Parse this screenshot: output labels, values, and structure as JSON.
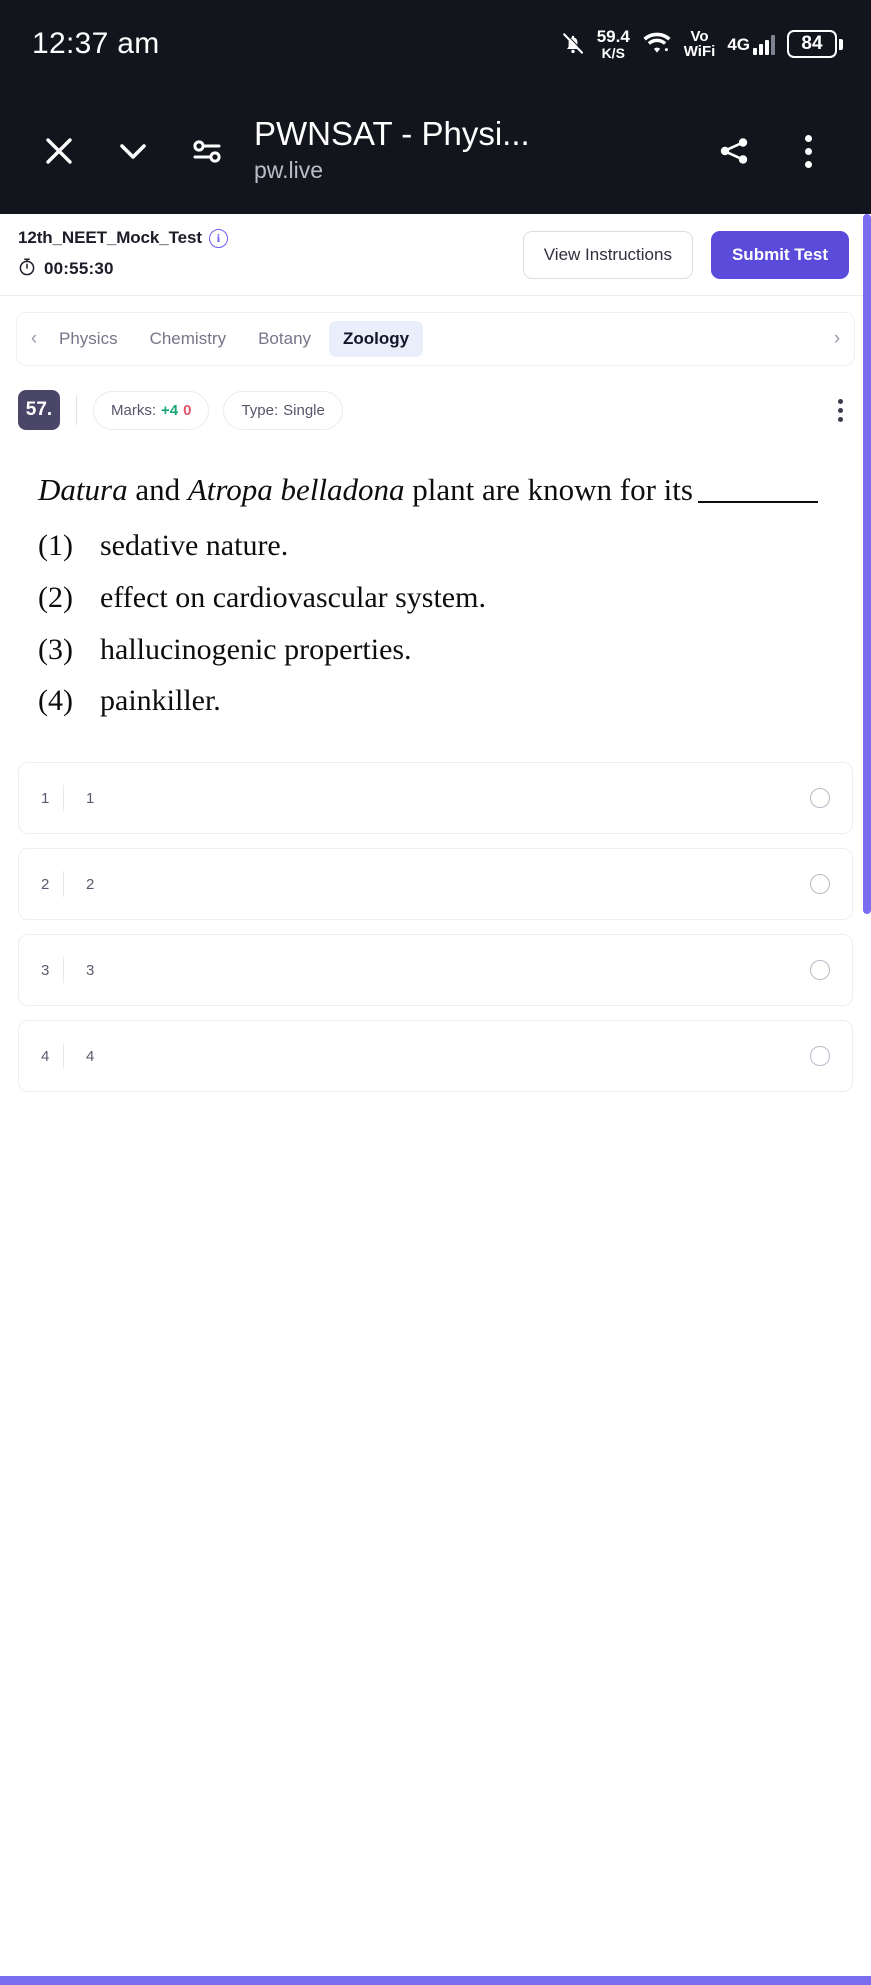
{
  "status_bar": {
    "time": "12:37 am",
    "network_speed_value": "59.4",
    "network_speed_unit": "K/S",
    "vo_line1": "Vo",
    "vo_line2": "WiFi",
    "network_gen": "4G",
    "battery_level": "84",
    "icons": [
      "bell-mute-icon",
      "wifi-icon",
      "signal-bars-icon",
      "battery-icon"
    ]
  },
  "browser": {
    "close_label": "✕",
    "page_title": "PWNSAT - Physi...",
    "host": "pw.live",
    "icons": [
      "close-icon",
      "chevron-down-icon",
      "tune-icon",
      "share-icon",
      "overflow-menu-icon"
    ]
  },
  "test_header": {
    "test_name": "12th_NEET_Mock_Test",
    "info_glyph": "i",
    "timer": "00:55:30",
    "view_instructions_label": "View Instructions",
    "submit_label": "Submit Test",
    "primary_color": "#5a4bda"
  },
  "tabs": {
    "prev_arrow": "‹",
    "next_arrow": "›",
    "items": [
      {
        "label": "Physics",
        "active": false
      },
      {
        "label": "Chemistry",
        "active": false
      },
      {
        "label": "Botany",
        "active": false
      },
      {
        "label": "Zoology",
        "active": true
      }
    ],
    "active_bg": "#e9eefb"
  },
  "question": {
    "number": "57.",
    "marks_label": "Marks:",
    "marks_positive": "+4",
    "marks_negative": "0",
    "type_label": "Type:",
    "type_value": "Single",
    "stem_part1": "Datura",
    "stem_part2": " and ",
    "stem_part3": "Atropa belladona",
    "stem_part4": " plant are known for its",
    "options": [
      {
        "num": "(1)",
        "text": "sedative nature."
      },
      {
        "num": "(2)",
        "text": "effect on cardiovascular system."
      },
      {
        "num": "(3)",
        "text": "hallucinogenic properties."
      },
      {
        "num": "(4)",
        "text": "painkiller."
      }
    ]
  },
  "answer_rows": [
    {
      "index": "1",
      "label": "1",
      "selected": false
    },
    {
      "index": "2",
      "label": "2",
      "selected": false
    },
    {
      "index": "3",
      "label": "3",
      "selected": false
    },
    {
      "index": "4",
      "label": "4",
      "selected": false
    }
  ],
  "scrollbar_color": "#7a6ef0"
}
